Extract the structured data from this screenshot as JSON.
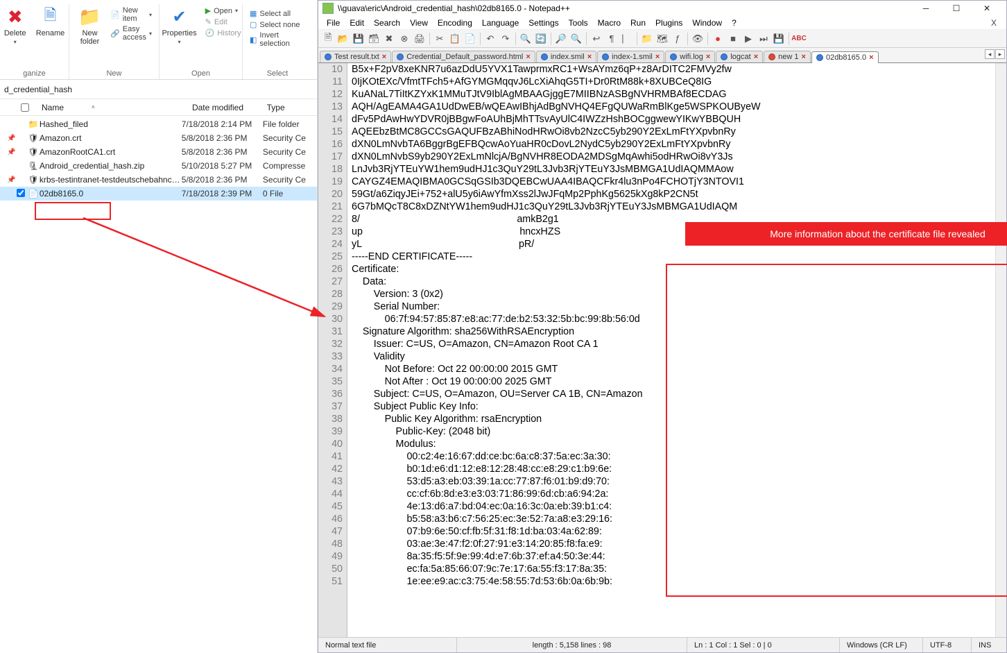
{
  "explorer": {
    "ribbon": {
      "organize": {
        "label": "ganize",
        "delete": "Delete",
        "rename": "Rename"
      },
      "new": {
        "label": "New",
        "newfolder": "New\nfolder",
        "newitem": "New item",
        "easyaccess": "Easy access"
      },
      "open": {
        "label": "Open",
        "properties": "Properties",
        "open": "Open",
        "edit": "Edit",
        "history": "History"
      },
      "select": {
        "label": "Select",
        "all": "Select all",
        "none": "Select none",
        "invert": "Invert selection"
      }
    },
    "breadcrumb": "d_credential_hash",
    "columns": {
      "name": "Name",
      "date": "Date modified",
      "type": "Type"
    },
    "rows": [
      {
        "icon": "folder",
        "name": "Hashed_filed",
        "date": "7/18/2018 2:14 PM",
        "type": "File folder",
        "pin": false,
        "checked": false
      },
      {
        "icon": "cert",
        "name": "Amazon.crt",
        "date": "5/8/2018 2:36 PM",
        "type": "Security Ce",
        "pin": true,
        "checked": false
      },
      {
        "icon": "cert",
        "name": "AmazonRootCA1.crt",
        "date": "5/8/2018 2:36 PM",
        "type": "Security Ce",
        "pin": true,
        "checked": false
      },
      {
        "icon": "zip",
        "name": "Android_credential_hash.zip",
        "date": "5/10/2018 5:27 PM",
        "type": "Compresse",
        "pin": false,
        "checked": false
      },
      {
        "icon": "cert",
        "name": "krbs-testintranet-testdeutschebahnco…",
        "date": "5/8/2018 2:36 PM",
        "type": "Security Ce",
        "pin": true,
        "checked": false
      },
      {
        "icon": "file",
        "name": "02db8165.0",
        "date": "7/18/2018 2:39 PM",
        "type": "0 File",
        "pin": false,
        "checked": true,
        "selected": true
      }
    ]
  },
  "npp": {
    "title": "\\\\guava\\eric\\Android_credential_hash\\02db8165.0 - Notepad++",
    "menu": [
      "File",
      "Edit",
      "Search",
      "View",
      "Encoding",
      "Language",
      "Settings",
      "Tools",
      "Macro",
      "Run",
      "Plugins",
      "Window",
      "?"
    ],
    "tabs": [
      {
        "label": "Test result.txt",
        "dirty": false
      },
      {
        "label": "Credential_Default_password.html",
        "dirty": false
      },
      {
        "label": "index.smil",
        "dirty": false
      },
      {
        "label": "index-1.smil",
        "dirty": false
      },
      {
        "label": "wifi.log",
        "dirty": false
      },
      {
        "label": "logcat",
        "dirty": false
      },
      {
        "label": "new 1",
        "dirty": true
      },
      {
        "label": "02db8165.0",
        "dirty": false,
        "active": true
      }
    ],
    "first_line_no": 10,
    "lines": [
      "B5x+F2pV8xeKNR7u6azDdU5YVX1TawprmxRC1+WsAYmz6qP+z8ArDITC2FMVy2fw",
      "0IjKOtEXc/VfmtTFch5+AfGYMGMqqvJ6LcXiAhqG5TI+Dr0RtM88k+8XUBCeQ8IG",
      "KuANaL7TiItKZYxK1MMuTJtV9IblAgMBAAGjggE7MIIBNzASBgNVHRMBAf8ECDAG",
      "AQH/AgEAMA4GA1UdDwEB/wQEAwIBhjAdBgNVHQ4EFgQUWaRmBlKge5WSPKOUByeW",
      "dFv5PdAwHwYDVR0jBBgwFoAUhBjMhTTsvAyUlC4IWZzHshBOCggwewYIKwYBBQUH",
      "AQEEbzBtMC8GCCsGAQUFBzABhiNodHRwOi8vb2NzcC5yb290Y2ExLmFtYXpvbnRy",
      "dXN0LmNvbTA6BggrBgEFBQcwAoYuaHR0cDovL2NydC5yb290Y2ExLmFtYXpvbnRy",
      "dXN0LmNvbS9yb290Y2ExLmNlcjA/BgNVHR8EODA2MDSgMqAwhi5odHRwOi8vY3Js",
      "LnJvb3RjYTEuYW1hem9udHJ1c3QuY29tL3Jvb3RjYTEuY3JsMBMGA1UdIAQMMAow",
      "CAYGZ4EMAQIBMA0GCSqGSIb3DQEBCwUAA4IBAQCFkr4lu3nPo4FCHOTjY3NTOVI1",
      "59Gt/a6ZiqyJEi+752+alU5y6iAwYfmXss2lJwJFqMp2PphKg5625kXg8kP2CN5t",
      "6G7bMQcT8C8xDZNtYW1hem9udHJ1c3QuY29tL3Jvb3RjYTEuY3JsMBMGA1UdIAQM",
      "8/                                                         amkB2g1",
      "up                                                         hncxHZS",
      "yL                                                         pR/",
      "-----END CERTIFICATE-----",
      "Certificate:",
      "    Data:",
      "        Version: 3 (0x2)",
      "        Serial Number:",
      "            06:7f:94:57:85:87:e8:ac:77:de:b2:53:32:5b:bc:99:8b:56:0d",
      "    Signature Algorithm: sha256WithRSAEncryption",
      "        Issuer: C=US, O=Amazon, CN=Amazon Root CA 1",
      "        Validity",
      "            Not Before: Oct 22 00:00:00 2015 GMT",
      "            Not After : Oct 19 00:00:00 2025 GMT",
      "        Subject: C=US, O=Amazon, OU=Server CA 1B, CN=Amazon",
      "        Subject Public Key Info:",
      "            Public Key Algorithm: rsaEncryption",
      "                Public-Key: (2048 bit)",
      "                Modulus:",
      "                    00:c2:4e:16:67:dd:ce:bc:6a:c8:37:5a:ec:3a:30:",
      "                    b0:1d:e6:d1:12:e8:12:28:48:cc:e8:29:c1:b9:6e:",
      "                    53:d5:a3:eb:03:39:1a:cc:77:87:f6:01:b9:d9:70:",
      "                    cc:cf:6b:8d:e3:e3:03:71:86:99:6d:cb:a6:94:2a:",
      "                    4e:13:d6:a7:bd:04:ec:0a:16:3c:0a:eb:39:b1:c4:",
      "                    b5:58:a3:b6:c7:56:25:ec:3e:52:7a:a8:e3:29:16:",
      "                    07:b9:6e:50:cf:fb:5f:31:f8:1d:ba:03:4a:62:89:",
      "                    03:ae:3e:47:f2:0f:27:91:e3:14:20:85:f8:fa:e9:",
      "                    8a:35:f5:5f:9e:99:4d:e7:6b:37:ef:a4:50:3e:44:",
      "                    ec:fa:5a:85:66:07:9c:7e:17:6a:55:f3:17:8a:35:",
      "                    1e:ee:e9:ac:c3:75:4e:58:55:7d:53:6b:0a:6b:9b:"
    ],
    "status": {
      "mode": "Normal text file",
      "length": "length : 5,158    lines : 98",
      "pos": "Ln : 1    Col : 1    Sel : 0 | 0",
      "eol": "Windows (CR LF)",
      "enc": "UTF-8",
      "ins": "INS"
    }
  },
  "annotation": "More information about the certificate file revealed"
}
